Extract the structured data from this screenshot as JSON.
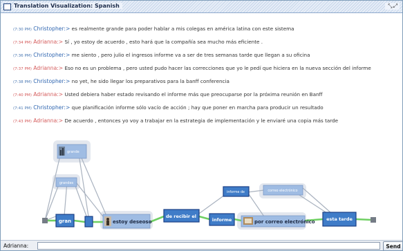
{
  "window": {
    "title": "Translation Visualization: Spanish",
    "controls": " ⤡⤢"
  },
  "messages": [
    {
      "time": "(7:30 PM)",
      "speaker": "Christopher:>",
      "role": "c",
      "text": "es realmente grande para poder hablar a mis colegas en américa latina con este sistema"
    },
    {
      "time": "(7:34 PM)",
      "speaker": "Adrianna:>",
      "role": "a",
      "text": "Sí , yo estoy de acuerdo , esto hará que la compañía sea mucho más eficiente ."
    },
    {
      "time": "(7:36 PM)",
      "speaker": "Christopher:>",
      "role": "c",
      "text": "me siento , pero julio el ingresos informe va a ser de tres semanas tarde que llegan a su oficina"
    },
    {
      "time": "(7:37 PM)",
      "speaker": "Adrianna:>",
      "role": "a",
      "text": "Eso no es un problema , pero usted pudo hacer las correcciones que yo le pedí que hiciera en la nueva sección del informe"
    },
    {
      "time": "(7:38 PM)",
      "speaker": "Christopher:>",
      "role": "c",
      "text": "no yet, he sido llegar los preparativos para la banff conferencia"
    },
    {
      "time": "(7:40 PM)",
      "speaker": "Adrianna:>",
      "role": "a",
      "text": "Usted debiera haber estado revisando el informe más que preocuparse por la próxima reunión en Banff"
    },
    {
      "time": "(7:41 PM)",
      "speaker": "Christopher:>",
      "role": "c",
      "text": "que planificación informe sólo vacío de acción ; hay que poner en marcha para producir un resultado"
    },
    {
      "time": "(7:43 PM)",
      "speaker": "Adrianna:>",
      "role": "a",
      "text": "De acuerdo , entonces yo voy a trabajar en la estrategia de implementación y le enviaré una copia más tarde"
    }
  ],
  "graph": {
    "nodes": {
      "grande_img": "grande",
      "grandes": "grandes",
      "gran": "gran",
      "estoy_deseoso": "estoy deseoso",
      "de_recibir_el": "de recibir el",
      "informe_alt": "informe de",
      "informe": "informe",
      "correo_alt": "correo electrónico",
      "por_correo": "por correo electrónico",
      "esta_tarde": "esta tarde"
    },
    "colors": {
      "node_fill": "#3f7cc8",
      "node_border": "#1b3f86",
      "node_alt_fill": "#9fbce3",
      "halo": "#e3e7ee",
      "edge_green": "#6fcf62",
      "edge_gray": "#a9b2bf"
    }
  },
  "input": {
    "label": "Adrianna:",
    "value": "",
    "placeholder": ""
  },
  "send_label": "Send"
}
